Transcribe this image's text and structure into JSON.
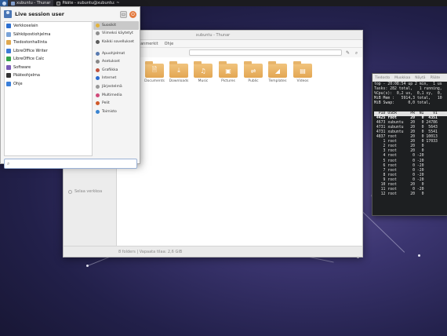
{
  "taskbar": {
    "tasks": [
      {
        "label": "xubuntu - Thunar",
        "active": true,
        "icon": "folder-icon"
      },
      {
        "label": "Pääte - xubuntu@xubuntu: ~",
        "active": false,
        "icon": "terminal-icon"
      }
    ]
  },
  "whisker": {
    "username": "Live session user",
    "search_placeholder": "",
    "favorites": [
      {
        "label": "Verkkoselain",
        "color": "#2c6fd1"
      },
      {
        "label": "Sähköpostiohjelma",
        "color": "#7aa3d8"
      },
      {
        "label": "Tiedostonhallinta",
        "color": "#e0a84e"
      },
      {
        "label": "LibreOffice Writer",
        "color": "#3d7ad6"
      },
      {
        "label": "LibreOffice Calc",
        "color": "#33a34a"
      },
      {
        "label": "Software",
        "color": "#7a5bb7"
      },
      {
        "label": "Pääteohjelma",
        "color": "#333333"
      },
      {
        "label": "Ohje",
        "color": "#3a7fd9"
      }
    ],
    "categories": [
      {
        "label": "Suosikit",
        "color": "#e2b23a",
        "selected": true
      },
      {
        "label": "Viimeksi käytetyt",
        "color": "#8e8e8e"
      },
      {
        "label": "Kaikki sovellukset",
        "color": "#5b5b5b"
      },
      {
        "label": "Apuohjelmat",
        "color": "#5a7bb0"
      },
      {
        "label": "Asetukset",
        "color": "#888888"
      },
      {
        "label": "Grafiikka",
        "color": "#c0523e"
      },
      {
        "label": "Internet",
        "color": "#2a6ad0"
      },
      {
        "label": "Järjestelmä",
        "color": "#999999"
      },
      {
        "label": "Multimedia",
        "color": "#d04a7a"
      },
      {
        "label": "Pelit",
        "color": "#d05a2a"
      },
      {
        "label": "Toimisto",
        "color": "#3a84d0"
      }
    ]
  },
  "thunar": {
    "title": "xubuntu - Thunar",
    "menu": [
      "Kirjanmerkit",
      "Ohje"
    ],
    "sidebar_items": [
      "Selaa verkkoa"
    ],
    "folders": [
      {
        "label": "Documents",
        "glyph": "🗎"
      },
      {
        "label": "Downloads",
        "glyph": "⤓"
      },
      {
        "label": "Music",
        "glyph": "♫"
      },
      {
        "label": "Pictures",
        "glyph": "▣"
      },
      {
        "label": "Public",
        "glyph": "⇌"
      },
      {
        "label": "Templates",
        "glyph": "◢"
      },
      {
        "label": "Videos",
        "glyph": "▤"
      }
    ],
    "status": "8 folders  |  Vapaata tilaa: 2,6 GiB"
  },
  "terminal": {
    "menu": [
      "Tiedosto",
      "Muokkaa",
      "Näytä",
      "Pääte"
    ],
    "top_lines": [
      "top - 20:08:54 up 2 min,  1 us",
      "Tasks: 282 total,   1 running,",
      "%Cpu(s):  0,2 us,  0,1 sy,  0,",
      "MiB Mem :   5914,3 total,   10",
      "MiB Swap:      0,0 total,"
    ],
    "header": "  PID USER      PR  NI    VI",
    "rows": [
      " 4425 root      20   0  4351",
      " 4673 xubuntu   20   0 24786",
      " 4731 xubuntu   20   0  5643",
      " 4731 xubuntu   20   0  5541",
      " 4837 root      20   0 10013",
      "    1 root      20   0 17033",
      "    2 root      20   0",
      "    3 root      20   0",
      "    4 root       0 -20",
      "    5 root       0 -20",
      "    6 root       0 -20",
      "    7 root       0 -20",
      "    8 root       0 -20",
      "    9 root       0 -20",
      "   10 root      20   0",
      "   11 root       0 -20",
      "   12 root      20   0"
    ]
  }
}
